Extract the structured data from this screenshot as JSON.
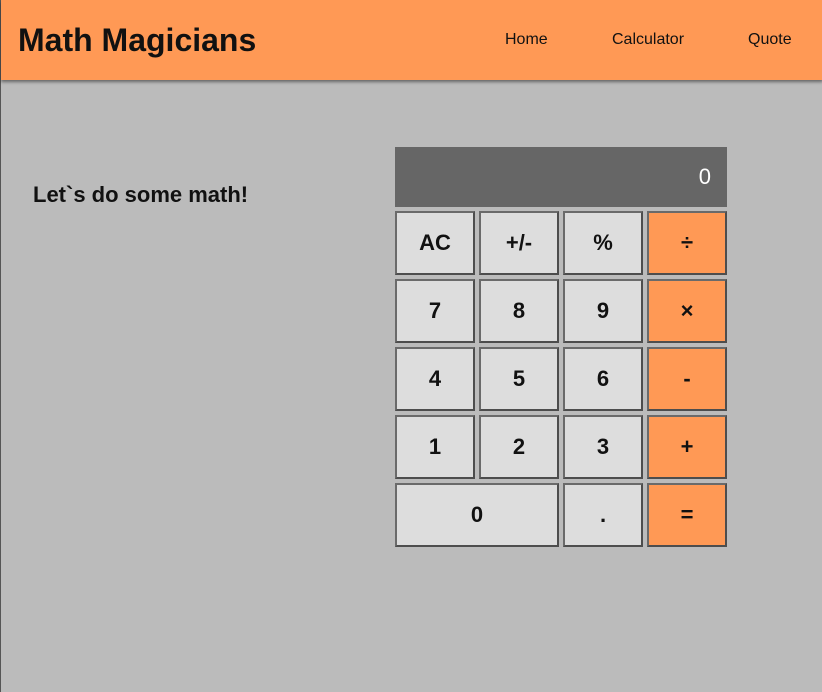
{
  "app": {
    "title": "Math Magicians"
  },
  "nav": {
    "items": [
      {
        "label": "Home"
      },
      {
        "label": "Calculator"
      },
      {
        "label": "Quote"
      }
    ]
  },
  "main": {
    "heading": "Let`s do some math!"
  },
  "calculator": {
    "display_value": "0",
    "keys": [
      {
        "label": "AC",
        "name": "all-clear"
      },
      {
        "label": "+/-",
        "name": "toggle-sign"
      },
      {
        "label": "%",
        "name": "percent"
      },
      {
        "label": "÷",
        "name": "divide"
      },
      {
        "label": "7",
        "name": "digit-7"
      },
      {
        "label": "8",
        "name": "digit-8"
      },
      {
        "label": "9",
        "name": "digit-9"
      },
      {
        "label": "×",
        "name": "multiply"
      },
      {
        "label": "4",
        "name": "digit-4"
      },
      {
        "label": "5",
        "name": "digit-5"
      },
      {
        "label": "6",
        "name": "digit-6"
      },
      {
        "label": "-",
        "name": "subtract"
      },
      {
        "label": "1",
        "name": "digit-1"
      },
      {
        "label": "2",
        "name": "digit-2"
      },
      {
        "label": "3",
        "name": "digit-3"
      },
      {
        "label": "+",
        "name": "add"
      },
      {
        "label": "0",
        "name": "digit-0"
      },
      {
        "label": ".",
        "name": "decimal"
      },
      {
        "label": "=",
        "name": "equals"
      }
    ]
  },
  "colors": {
    "accent": "#ff9955",
    "background": "#bbbbbb",
    "display": "#666666",
    "key": "#dddddd"
  }
}
